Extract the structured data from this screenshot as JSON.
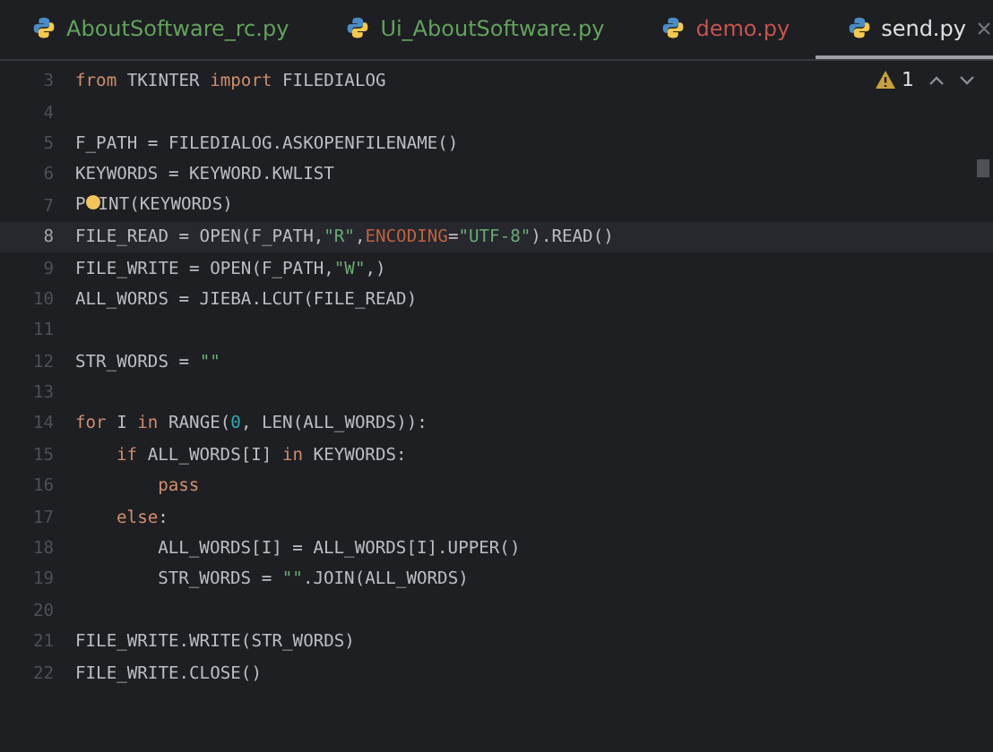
{
  "tabs": [
    {
      "label": "AboutSoftware_rc.py",
      "color": "#62a35c",
      "selected": false
    },
    {
      "label": "Ui_AboutSoftware.py",
      "color": "#62a35c",
      "selected": false
    },
    {
      "label": "demo.py",
      "color": "#c75450",
      "selected": false
    },
    {
      "label": "send.py",
      "color": "#dfe1e5",
      "selected": true
    }
  ],
  "inspections": {
    "warnings": "1"
  },
  "editor": {
    "lines": [
      {
        "number": "3",
        "current": false,
        "segments": [
          {
            "t": "from",
            "kind": "kw"
          },
          {
            "t": " TKINTER ",
            "kind": "id"
          },
          {
            "t": "import",
            "kind": "kw"
          },
          {
            "t": " FILEDIALOG",
            "kind": "id"
          }
        ]
      },
      {
        "number": "4",
        "current": false
      },
      {
        "number": "5",
        "current": false,
        "segments": [
          {
            "t": "F_PATH = FILEDIALOG.ASKOPENFILENAME()",
            "kind": "id"
          }
        ]
      },
      {
        "number": "6",
        "current": false,
        "segments": [
          {
            "t": "KEYWORDS = KEYWORD.KWLIST",
            "kind": "id"
          }
        ]
      },
      {
        "number": "7",
        "current": false,
        "segments": [
          {
            "t": "P",
            "kind": "id"
          },
          {
            "kind": "bulb"
          },
          {
            "t": "INT(KEYWORDS)",
            "kind": "id"
          }
        ]
      },
      {
        "number": "8",
        "current": true,
        "segments": [
          {
            "t": "FILE_READ = OPEN(F_PATH,",
            "kind": "id"
          },
          {
            "t": "\"R\"",
            "kind": "str"
          },
          {
            "t": ",",
            "kind": "id"
          },
          {
            "t": "ENCODING",
            "kind": "param"
          },
          {
            "t": "=",
            "kind": "id"
          },
          {
            "t": "\"UTF-8\"",
            "kind": "str"
          },
          {
            "t": ").READ()",
            "kind": "id"
          }
        ]
      },
      {
        "number": "9",
        "current": false,
        "segments": [
          {
            "t": "FILE_WRITE = OPEN(F_PATH,",
            "kind": "id"
          },
          {
            "t": "\"W\"",
            "kind": "str"
          },
          {
            "t": ",)",
            "kind": "id"
          }
        ]
      },
      {
        "number": "10",
        "current": false,
        "segments": [
          {
            "t": "ALL_WORDS = JIEBA.LCUT(FILE_READ)",
            "kind": "id"
          }
        ]
      },
      {
        "number": "11",
        "current": false
      },
      {
        "number": "12",
        "current": false,
        "segments": [
          {
            "t": "STR_WORDS = ",
            "kind": "id"
          },
          {
            "t": "\"\"",
            "kind": "str"
          }
        ]
      },
      {
        "number": "13",
        "current": false
      },
      {
        "number": "14",
        "current": false,
        "segments": [
          {
            "t": "for",
            "kind": "kw"
          },
          {
            "t": " I ",
            "kind": "id"
          },
          {
            "t": "in",
            "kind": "kw"
          },
          {
            "t": " RANGE(",
            "kind": "id"
          },
          {
            "t": "0",
            "kind": "num"
          },
          {
            "t": ", LEN(ALL_WORDS)):",
            "kind": "id"
          }
        ],
        "children": [
          {
            "number": "15",
            "current": false,
            "segments": [
              {
                "t": "if",
                "kind": "kw"
              },
              {
                "t": " ALL_WORDS[I] ",
                "kind": "id"
              },
              {
                "t": "in",
                "kind": "kw"
              },
              {
                "t": " KEYWORDS:",
                "kind": "id"
              }
            ],
            "children": [
              {
                "number": "16",
                "current": false,
                "segments": [
                  {
                    "t": "pass",
                    "kind": "kw"
                  }
                ]
              }
            ]
          },
          {
            "number": "17",
            "current": false,
            "segments": [
              {
                "t": "else",
                "kind": "kw"
              },
              {
                "t": ":",
                "kind": "id"
              }
            ],
            "children": [
              {
                "number": "18",
                "current": false,
                "segments": [
                  {
                    "t": "ALL_WORDS[I] = ALL_WORDS[I].UPPER()",
                    "kind": "id"
                  }
                ]
              },
              {
                "number": "19",
                "current": false,
                "segments": [
                  {
                    "t": "STR_WORDS = ",
                    "kind": "id"
                  },
                  {
                    "t": "\"\"",
                    "kind": "str"
                  },
                  {
                    "t": ".JOIN(ALL_WORDS)",
                    "kind": "id"
                  }
                ]
              }
            ]
          }
        ]
      },
      {
        "number": "20",
        "current": false
      },
      {
        "number": "21",
        "current": false,
        "segments": [
          {
            "t": "FILE_WRITE.WRITE(STR_WORDS)",
            "kind": "id"
          }
        ]
      },
      {
        "number": "22",
        "current": false,
        "segments": [
          {
            "t": "FILE_WRITE.CLOSE()",
            "kind": "id"
          }
        ]
      }
    ]
  }
}
